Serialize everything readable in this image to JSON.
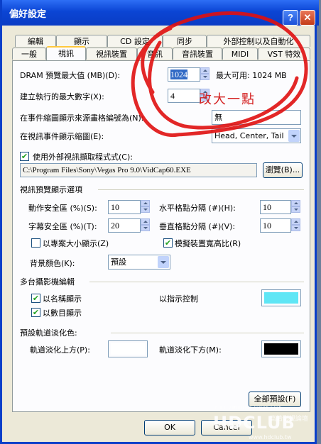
{
  "window": {
    "title": "偏好設定",
    "help_label": "?",
    "close_label": "✕"
  },
  "tabs_row1": [
    "編輯",
    "顯示",
    "CD 設定",
    "同步",
    "外部控制以及自動化"
  ],
  "tabs_row2": [
    "一般",
    "視訊",
    "視訊裝置",
    "音訊",
    "音訊裝置",
    "MIDI",
    "VST 特效"
  ],
  "active_tab": "視訊",
  "dram": {
    "label": "DRAM 預覽最大值 (MB)(D):",
    "value": "1024",
    "max_available": "最大可用: 1024 MB"
  },
  "threads": {
    "label": "建立執行的最大數字(X):",
    "value": "4"
  },
  "event_thumb_source": {
    "label": "在事件縮圖顯示來源畫格編號為(N):",
    "value": "無"
  },
  "event_thumb": {
    "label": "在視訊事件顯示縮圖(E):",
    "value": "Head, Center, Tail"
  },
  "external_codec": {
    "checkbox_label": "使用外部視訊擷取程式式(C):",
    "checked": true,
    "path": "C:\\Program Files\\Sony\\Vegas Pro 9.0\\VidCap60.EXE",
    "browse_label": "瀏覽(B)..."
  },
  "preview_section": {
    "title": "視訊預覽顯示選項",
    "action_safe_label": "動作安全區 (%)(S):",
    "action_safe_value": "10",
    "title_safe_label": "字幕安全區 (%)(T):",
    "title_safe_value": "20",
    "h_grid_label": "水平格點分隔 (#)(H):",
    "h_grid_value": "10",
    "v_grid_label": "垂直格點分隔 (#)(V):",
    "v_grid_value": "10",
    "square_pixels_label": "以專案大小顯示(Z)",
    "square_pixels_checked": false,
    "simulate_aspect_label": "模擬裝置寬高比(R)",
    "simulate_aspect_checked": true,
    "bg_color_label": "背景顏色(K):",
    "bg_color_value": "預設"
  },
  "multicam_section": {
    "title": "多台攝影機編輯",
    "show_names_label": "以名稱顯示",
    "show_names_checked": true,
    "show_numbers_label": "以數目顯示",
    "show_numbers_checked": true,
    "indicator_label": "以指示控制",
    "indicator_color": "#5fe6f5"
  },
  "track_fade_section": {
    "title": "預設軌道淡化色:",
    "top_label": "軌道淡化上方(P):",
    "top_color": "#ffffff",
    "bottom_label": "軌道淡化下方(M):",
    "bottom_color": "#000000"
  },
  "defaults_button": "全部預設(F)",
  "ok_button": "OK",
  "cancel_button": "Cancel",
  "annotation": {
    "handwritten_note": "改大一點",
    "ink_color": "#e01010"
  },
  "watermark": {
    "brand": "HDCLUB",
    "tagline": "High Definition Vision Club",
    "cn_name": "高清影視論壇",
    "url": "www.hdclub.tw"
  }
}
